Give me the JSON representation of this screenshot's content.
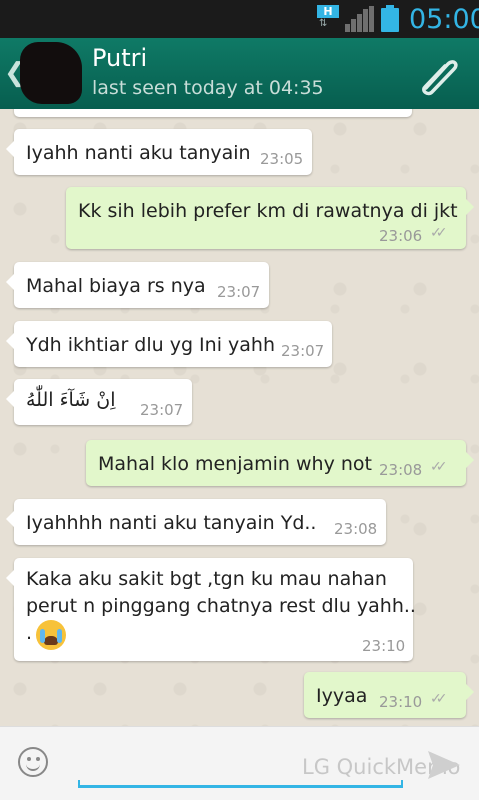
{
  "status_bar": {
    "network_badge": "H",
    "time": "05:00"
  },
  "header": {
    "contact_name": "Putri",
    "last_seen": "last seen today at 04:35"
  },
  "messages": [
    {
      "dir": "in",
      "text": "Iyahh nanti aku tanyain",
      "time": "23:05"
    },
    {
      "dir": "out",
      "text": "Kk sih lebih prefer km di rawatnya di jkt",
      "time": "23:06"
    },
    {
      "dir": "in",
      "text": "Mahal biaya rs nya",
      "time": "23:07"
    },
    {
      "dir": "in",
      "text": "Ydh ikhtiar dlu yg Ini yahh",
      "time": "23:07"
    },
    {
      "dir": "in",
      "text": "اِنْ شَآءَ اللّٰهُ",
      "time": "23:07"
    },
    {
      "dir": "out",
      "text": "Mahal klo menjamin why not",
      "time": "23:08"
    },
    {
      "dir": "in",
      "text": "Iyahhhh nanti aku tanyain Yd..",
      "time": "23:08"
    },
    {
      "dir": "in",
      "text": "Kaka aku sakit bgt ,tgn ku mau nahan\nperut n pinggang chatnya rest dlu yahh..\n.",
      "time": "23:10",
      "emoji": "crying-face"
    },
    {
      "dir": "out",
      "text": "Iyyaa",
      "time": "23:10"
    }
  ],
  "input_bar": {
    "watermark": "LG QuickMemo"
  },
  "colors": {
    "header_bg": "#075e4f",
    "outgoing_bubble": "#e2f7cb",
    "incoming_bubble": "#ffffff",
    "accent": "#33b5e5"
  }
}
